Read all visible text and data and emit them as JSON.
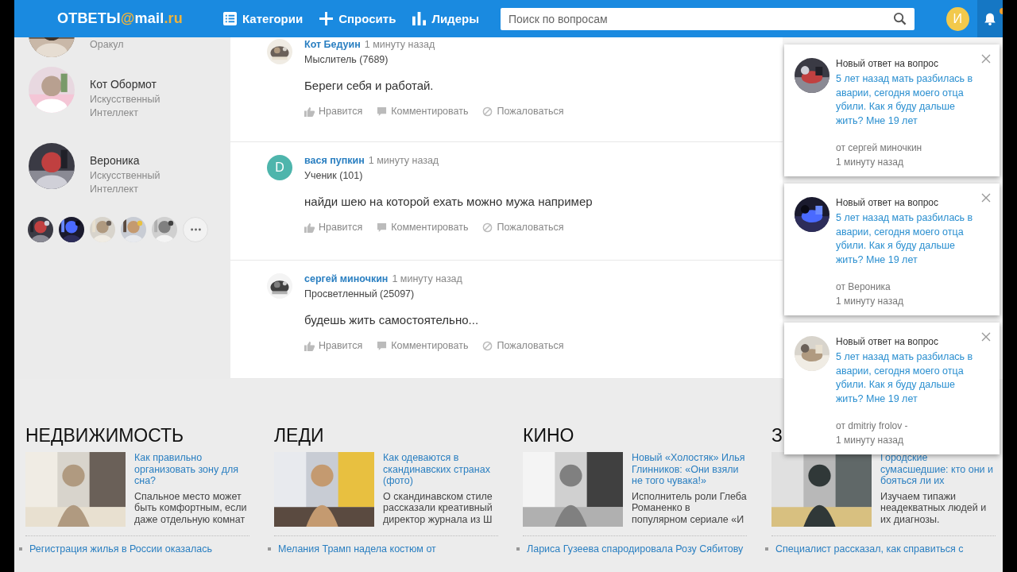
{
  "header": {
    "logo_parts": [
      {
        "text": "ОТВЕТЫ",
        "accent": false
      },
      {
        "text": "@",
        "accent": true
      },
      {
        "text": "mail",
        "accent": false
      },
      {
        "text": ".ru",
        "accent": true
      }
    ],
    "nav": [
      {
        "label": "Категории",
        "kind": "list"
      },
      {
        "label": "Спросить",
        "kind": "plus"
      },
      {
        "label": "Лидеры",
        "kind": "bars"
      }
    ],
    "search": {
      "placeholder": "Поиск по вопросам"
    },
    "user_initial": "И"
  },
  "sidebar": {
    "leaders": [
      {
        "rank": "Оракул",
        "cropped": true
      },
      {
        "name": "Кот Обормот",
        "rank": "Искусственный Интеллект",
        "cropped": false
      },
      {
        "name": "Вероника",
        "rank": "Искусственный Интеллект",
        "cropped": false
      }
    ]
  },
  "answers": [
    {
      "author": "Кот Бедуин",
      "time": "1 минуту назад",
      "rank": "Мыслитель (7689)",
      "kind": "picture",
      "text": "Береги себя и работай.",
      "actions": [
        "Нравится",
        "Комментировать",
        "Пожаловаться"
      ]
    },
    {
      "author": "вася пупкин",
      "time": "1 минуту назад",
      "rank": "Ученик (101)",
      "kind": "letter",
      "letter": "D",
      "text": "найди шею на которой ехать можно мужа например",
      "actions": [
        "Нравится",
        "Комментировать",
        "Пожаловаться"
      ]
    },
    {
      "author": "сергей миночкин",
      "time": "1 минуту назад",
      "rank": "Просветленный (25097)",
      "kind": "picture",
      "text": "будешь жить самостоятельно...",
      "actions": [
        "Нравится",
        "Комментировать",
        "Пожаловаться"
      ]
    }
  ],
  "notifications": [
    {
      "title": "Новый ответ на вопрос",
      "question": "5 лет назад мать разбилась в аварии, сегодня моего отца убили. Как я буду дальше жить? Мне 19 лет",
      "from": "от сергей миночкин",
      "time": "1 минуту назад"
    },
    {
      "title": "Новый ответ на вопрос",
      "question": "5 лет назад мать разбилась в аварии, сегодня моего отца убили. Как я буду дальше жить? Мне 19 лет",
      "from": "от Вероника",
      "time": "1 минуту назад"
    },
    {
      "title": "Новый ответ на вопрос",
      "question": "5 лет назад мать разбилась в аварии, сегодня моего отца убили. Как я буду дальше жить? Мне 19 лет",
      "from": "от dmitriy frolov -",
      "time": "1 минуту назад"
    }
  ],
  "news": [
    {
      "title": "НЕДВИЖИМОСТЬ",
      "headline": "Как правильно организовать зону для сна?",
      "description": "Спальное место может быть комфортным, если даже отдельную комнат",
      "link": "Регистрация жилья в России оказалась"
    },
    {
      "title": "ЛЕДИ",
      "headline": "Как одеваются в скандинавских странах (фото)",
      "description": "О скандинавском стиле рассказали креативный директор журнала из Ш",
      "link": "Мелания Трамп надела костюм от"
    },
    {
      "title": "КИНО",
      "headline": "Новый «Холостяк» Илья Глинников: «Они взяли не того чувака!»",
      "description": "Исполнитель роли Глеба Романенко в популярном сериале «И",
      "link": "Лариса Гузеева спародировала Розу Сябитову"
    },
    {
      "title": "З",
      "headline": "Городские сумасшедшие: кто они и бояться ли их",
      "description": "Изучаем типажи неадекватных людей и их диагнозы.",
      "link": "Специалист рассказал, как справиться с"
    }
  ]
}
